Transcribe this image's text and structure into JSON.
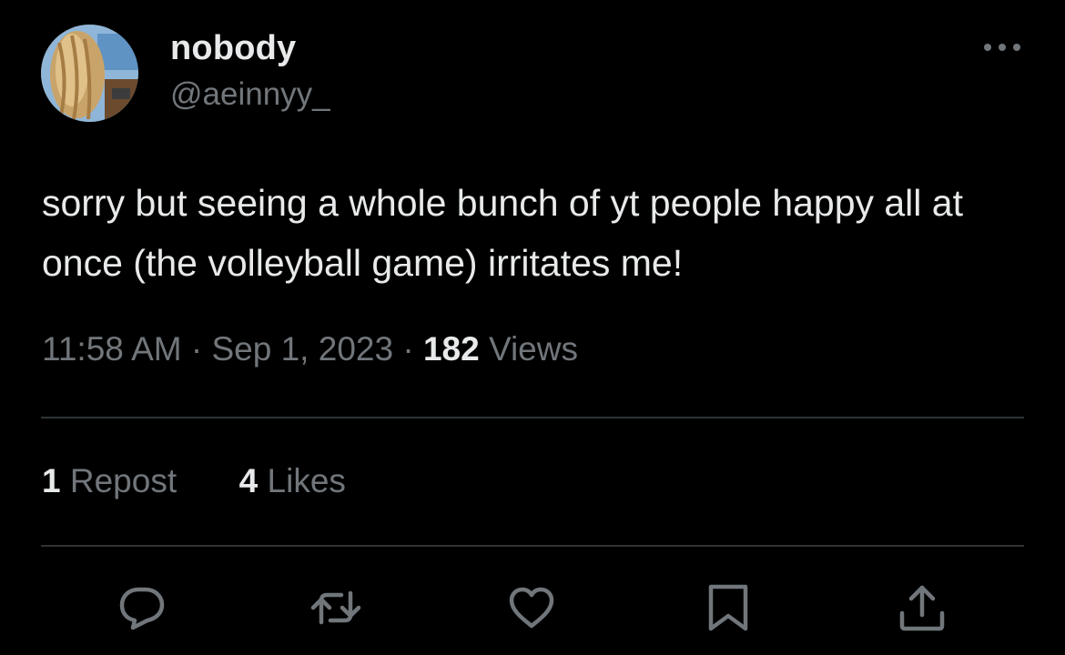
{
  "user": {
    "display_name": "nobody",
    "handle": "@aeinnyy_",
    "avatar_icon": "avatar-photo"
  },
  "tweet": {
    "text": "sorry but seeing a whole bunch of yt people happy all at once (the volleyball game) irritates me!",
    "time": "11:58 AM",
    "separator": "·",
    "date": "Sep 1, 2023",
    "views_count": "182",
    "views_label": "Views"
  },
  "stats": {
    "reposts_count": "1",
    "reposts_label": "Repost",
    "likes_count": "4",
    "likes_label": "Likes"
  },
  "actions": [
    {
      "icon": "reply-icon"
    },
    {
      "icon": "repost-icon"
    },
    {
      "icon": "like-icon"
    },
    {
      "icon": "bookmark-icon"
    },
    {
      "icon": "share-icon"
    }
  ],
  "more_icon": "more-horizontal-icon",
  "colors": {
    "background": "#000000",
    "primary_text": "#e7e9ea",
    "secondary_text": "#71767b",
    "divider": "#2f3336"
  }
}
